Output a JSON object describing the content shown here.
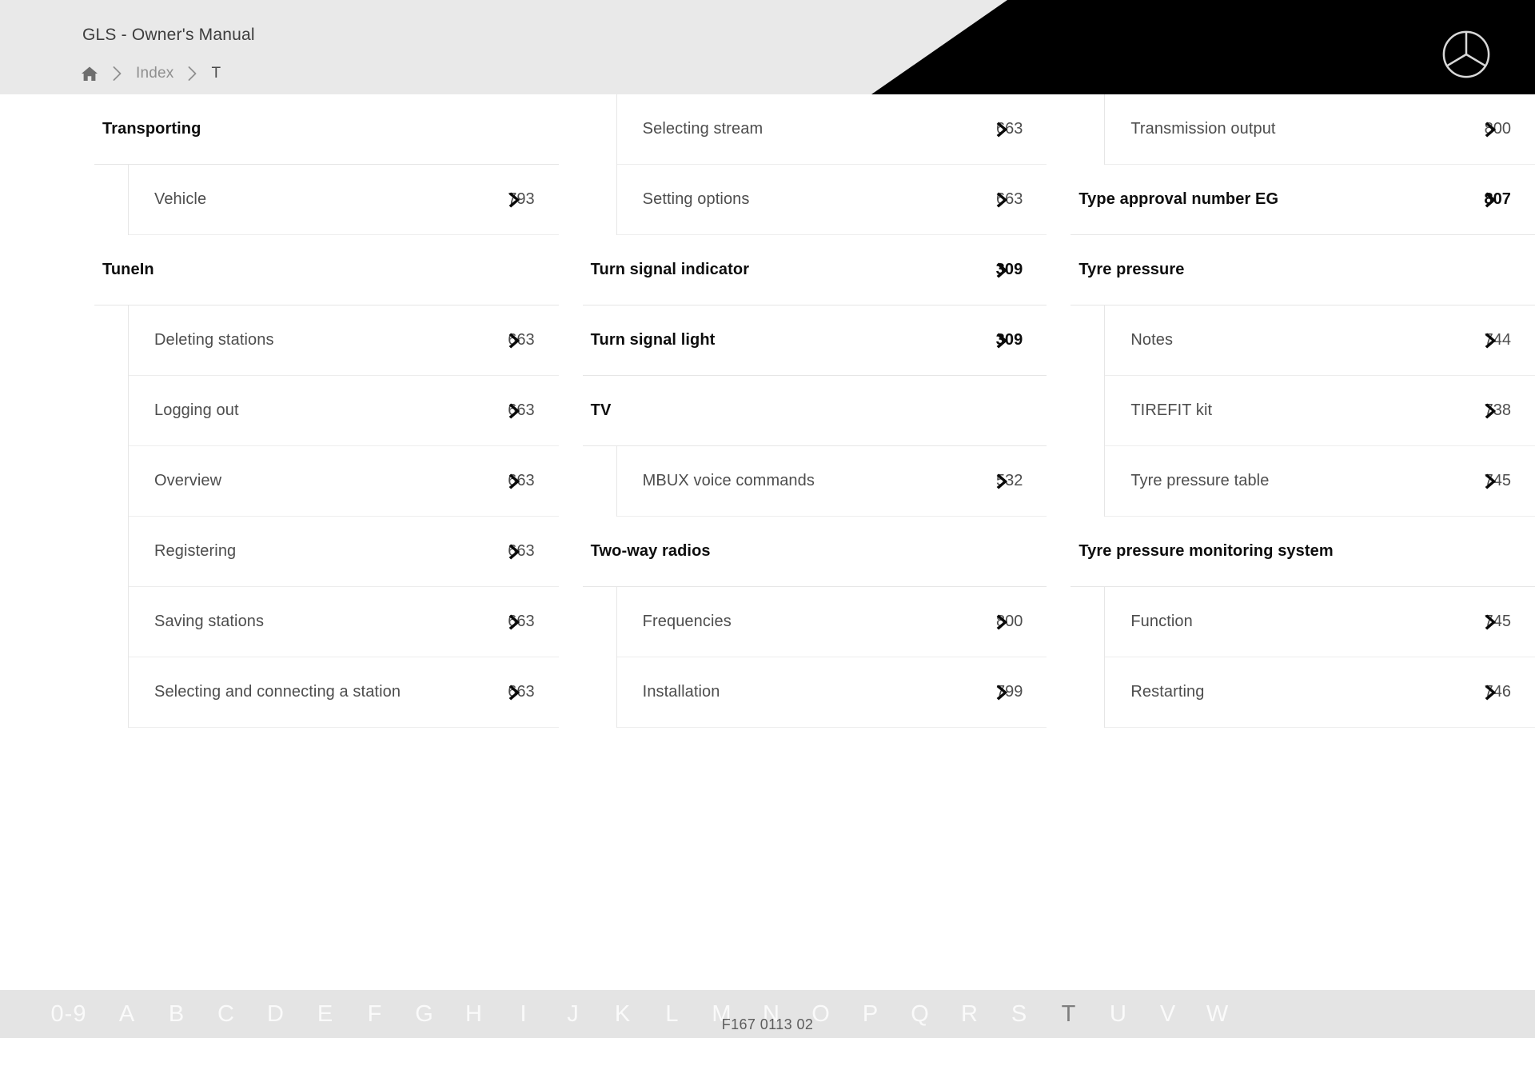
{
  "header": {
    "title": "GLS - Owner's Manual",
    "breadcrumb": {
      "home_icon": "home-icon",
      "separator_icon": "chevron-right-icon",
      "items": [
        {
          "label": "Index",
          "current": false
        },
        {
          "label": "T",
          "current": true
        }
      ]
    },
    "brand_logo_icon": "mercedes-benz-star-icon",
    "background": "#e9e9e9",
    "accent": "#000000"
  },
  "index": {
    "columns": [
      {
        "groups": [
          {
            "title": "Transporting",
            "page": null,
            "items": [
              {
                "label": "Vehicle",
                "page": "793"
              }
            ]
          },
          {
            "title": "TuneIn",
            "page": null,
            "items": [
              {
                "label": "Deleting stations",
                "page": "663"
              },
              {
                "label": "Logging out",
                "page": "663"
              },
              {
                "label": "Overview",
                "page": "663"
              },
              {
                "label": "Registering",
                "page": "663"
              },
              {
                "label": "Saving stations",
                "page": "663"
              },
              {
                "label": "Selecting and connecting a station",
                "page": "663"
              }
            ]
          }
        ]
      },
      {
        "groups": [
          {
            "title": null,
            "page": null,
            "items": [
              {
                "label": "Selecting stream",
                "page": "663"
              },
              {
                "label": "Setting options",
                "page": "663"
              }
            ]
          },
          {
            "title": "Turn signal indicator",
            "page": "309",
            "items": []
          },
          {
            "title": "Turn signal light",
            "page": "309",
            "items": []
          },
          {
            "title": "TV",
            "page": null,
            "items": [
              {
                "label": "MBUX voice commands",
                "page": "532"
              }
            ]
          },
          {
            "title": "Two-way radios",
            "page": null,
            "items": [
              {
                "label": "Frequencies",
                "page": "800"
              },
              {
                "label": "Installation",
                "page": "799"
              }
            ]
          }
        ]
      },
      {
        "groups": [
          {
            "title": null,
            "page": null,
            "items": [
              {
                "label": "Transmission output",
                "page": "800"
              }
            ]
          },
          {
            "title": "Type approval number EG",
            "page": "807",
            "items": []
          },
          {
            "title": "Tyre pressure",
            "page": null,
            "items": [
              {
                "label": "Notes",
                "page": "744"
              },
              {
                "label": "TIREFIT kit",
                "page": "738"
              },
              {
                "label": "Tyre pressure table",
                "page": "745"
              }
            ]
          },
          {
            "title": "Tyre pressure monitoring system",
            "page": null,
            "items": [
              {
                "label": "Function",
                "page": "745"
              },
              {
                "label": "Restarting",
                "page": "746"
              }
            ]
          }
        ]
      }
    ]
  },
  "alpha_nav": {
    "items": [
      {
        "label": "0-9",
        "active": false
      },
      {
        "label": "A",
        "active": false
      },
      {
        "label": "B",
        "active": false
      },
      {
        "label": "C",
        "active": false
      },
      {
        "label": "D",
        "active": false
      },
      {
        "label": "E",
        "active": false
      },
      {
        "label": "F",
        "active": false
      },
      {
        "label": "G",
        "active": false
      },
      {
        "label": "H",
        "active": false
      },
      {
        "label": "I",
        "active": false
      },
      {
        "label": "J",
        "active": false
      },
      {
        "label": "K",
        "active": false
      },
      {
        "label": "L",
        "active": false
      },
      {
        "label": "M",
        "active": false
      },
      {
        "label": "N",
        "active": false
      },
      {
        "label": "O",
        "active": false
      },
      {
        "label": "P",
        "active": false
      },
      {
        "label": "Q",
        "active": false
      },
      {
        "label": "R",
        "active": false
      },
      {
        "label": "S",
        "active": false
      },
      {
        "label": "T",
        "active": true
      },
      {
        "label": "U",
        "active": false
      },
      {
        "label": "V",
        "active": false
      },
      {
        "label": "W",
        "active": false
      }
    ],
    "active_letter": "T"
  },
  "footer": {
    "document_code": "F167 0113 02"
  }
}
